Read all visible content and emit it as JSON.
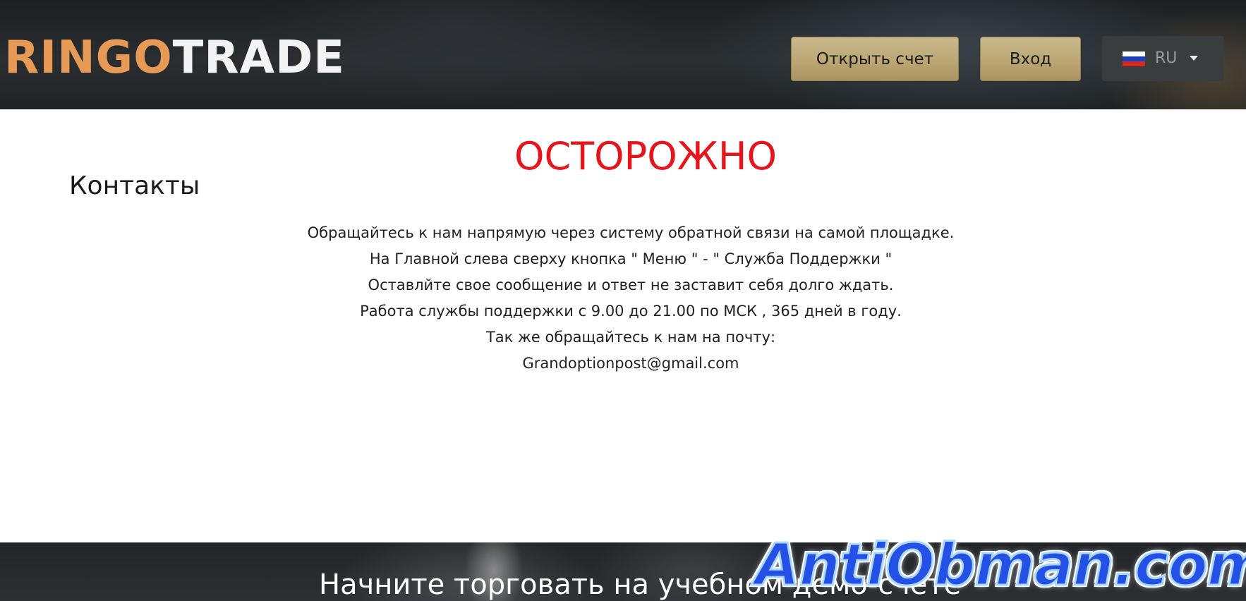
{
  "header": {
    "logo": {
      "part1": "RINGO",
      "part2": "TRADE",
      "colors": {
        "part1": "#e69a55",
        "part2": "#f3f3f3"
      }
    },
    "open_account_label": "Открыть счет",
    "login_label": "Вход",
    "language": {
      "code": "RU",
      "flag_icon": "russia-flag-icon"
    }
  },
  "main": {
    "warning": "ОСТОРОЖНО",
    "warning_color": "#e8141b",
    "title": "Контакты",
    "lines": [
      "Обращайтесь к нам напрямую через систему обратной связи на самой площадке.",
      "На Главной слева сверху кнопка \" Меню \" - \" Служба Поддержки \"",
      "Оставлйте свое сообщение и ответ не заставит себя долго ждать.",
      "Работа службы поддержки с 9.00 до 21.00 по МСК , 365 дней в году.",
      "Так же обращайтесь к нам на почту:",
      "Grandoptionpost@gmail.com"
    ]
  },
  "footer": {
    "title": "Начните торговать на учебном демо-счете"
  },
  "watermark": {
    "text": "AntiObman.com",
    "color": "#2450e6"
  }
}
